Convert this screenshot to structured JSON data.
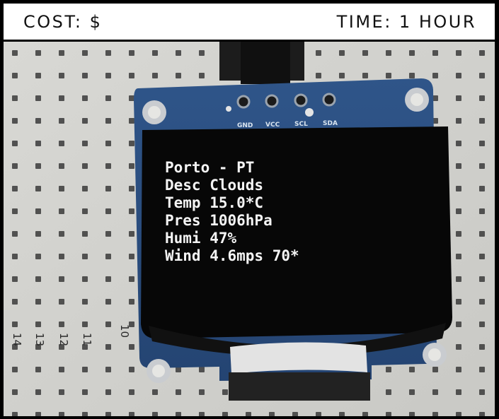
{
  "header": {
    "cost_label": "COST: $",
    "time_label": "TIME: 1 HOUR"
  },
  "module": {
    "pin_labels": [
      "GND",
      "VCC",
      "SCL",
      "SDA"
    ]
  },
  "display": {
    "lines": [
      "Porto - PT",
      "Desc Clouds",
      "Temp 15.0*C",
      "Pres 1006hPa",
      "Humi 47%",
      "Wind 4.6mps 70*"
    ]
  },
  "breadboard": {
    "row_numbers": [
      "14",
      "13",
      "12",
      "11",
      "10"
    ]
  },
  "colors": {
    "breadboard": "#dcdcd8",
    "pcb": "#2b4e80",
    "screen": "#070707",
    "text": "#f4f4f4"
  }
}
